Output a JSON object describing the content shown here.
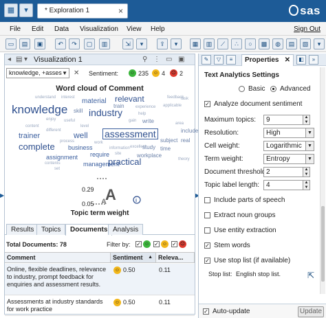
{
  "colors": {
    "titlebar": "#1d5b97",
    "positive": "#3cb53c",
    "neutral": "#f2b71a",
    "negative": "#e03a2e",
    "word": "#2e4f8e"
  },
  "titlebar": {
    "doc_tab": "* Exploration 1",
    "close": "×",
    "logo": "sas"
  },
  "menu": {
    "items": [
      "File",
      "Edit",
      "Data",
      "Visualization",
      "View",
      "Help"
    ],
    "sign_out": "Sign Out"
  },
  "visualization": {
    "title": "Visualization 1",
    "filter_value": "knowledge, +asses",
    "sentiment_label": "Sentiment:",
    "positive_count": "235",
    "neutral_count": "4",
    "negative_count": "2"
  },
  "wordcloud": {
    "title": "Word cloud of Comment",
    "words": [
      "knowledge",
      "industry",
      "material",
      "relevant",
      "assessment",
      "complete",
      "well",
      "trainer",
      "practical",
      "management",
      "business",
      "require",
      "assignment",
      "subject",
      "train",
      "skill",
      "experience",
      "information",
      "workplace",
      "set",
      "write",
      "real",
      "help",
      "include",
      "understand",
      "interest",
      "task",
      "enjoy",
      "applicable",
      "different",
      "useful",
      "process",
      "contents",
      "gain",
      "level",
      "work",
      "excellent",
      "content",
      "area",
      "feedback",
      "time",
      "study",
      "site",
      "theory"
    ]
  },
  "topic_weight": {
    "label": "Topic term weight",
    "max_label": "0.29",
    "min_label": "0.05",
    "info_icon": "info-icon"
  },
  "tabs": [
    "Results",
    "Topics",
    "Documents",
    "Analysis"
  ],
  "documents": {
    "total": "Total Documents: 78",
    "filter_by": "Filter by:",
    "columns": [
      "Comment",
      "Sentiment",
      "Releva..."
    ],
    "sort_indicator": "▲",
    "rows": [
      {
        "comment": "Online, flexible deadlines, relevance to industry, prompt feedback for enquiries and assessment results.",
        "sentiment": "0.50",
        "relevance": "0.11"
      },
      {
        "comment": "Assessments at industry standards for work practice",
        "sentiment": "0.50",
        "relevance": "0.11"
      }
    ]
  },
  "properties": {
    "tab_label": "Properties",
    "section_title": "Text Analytics Settings",
    "mode_basic": "Basic",
    "mode_advanced": "Advanced",
    "analyze_sentiment": "Analyze document sentiment",
    "fields": [
      {
        "label": "Maximum topics:",
        "value": "9",
        "kind": "spin"
      },
      {
        "label": "Resolution:",
        "value": "High",
        "kind": "dropdown"
      },
      {
        "label": "Cell weight:",
        "value": "Logarithmic",
        "kind": "dropdown"
      },
      {
        "label": "Term weight:",
        "value": "Entropy",
        "kind": "dropdown"
      },
      {
        "label": "Document threshold:",
        "value": "2",
        "kind": "spin"
      },
      {
        "label": "Topic label length:",
        "value": "4",
        "kind": "spin"
      }
    ],
    "checks": [
      {
        "label": "Include parts of speech",
        "checked": false
      },
      {
        "label": "Extract noun groups",
        "checked": false
      },
      {
        "label": "Use entity extraction",
        "checked": false
      },
      {
        "label": "Stem words",
        "checked": true
      },
      {
        "label": "Use stop list (if available)",
        "checked": true
      }
    ],
    "stop_list_label": "Stop list:",
    "stop_list_value": "English stop list.",
    "auto_update": "Auto-update",
    "update_button": "Update"
  }
}
